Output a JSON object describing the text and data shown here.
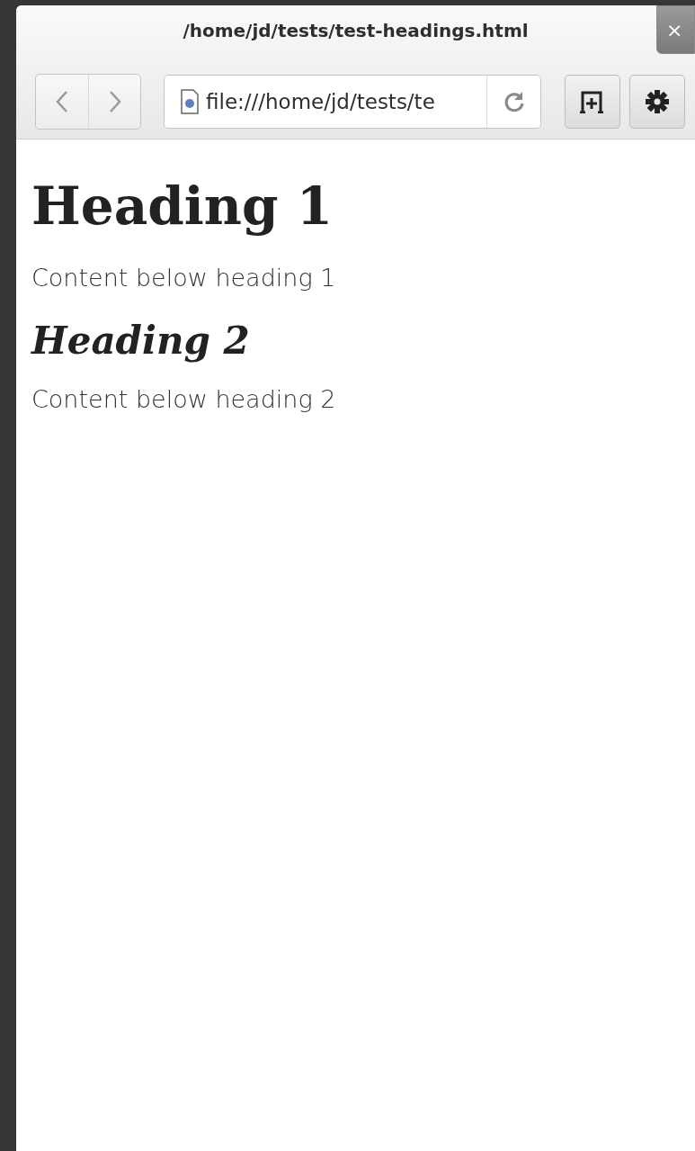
{
  "window": {
    "title": "/home/jd/tests/test-headings.html",
    "close": "×"
  },
  "toolbar": {
    "url": "file:///home/jd/tests/te"
  },
  "content": [
    {
      "kind": "h1",
      "text": "Heading 1"
    },
    {
      "kind": "p",
      "text": "Content below heading 1"
    },
    {
      "kind": "h2",
      "text": "Heading 2"
    },
    {
      "kind": "p",
      "text": "Content below heading 2"
    }
  ]
}
